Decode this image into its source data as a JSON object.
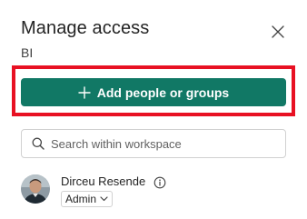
{
  "header": {
    "title": "Manage access",
    "subtitle": "BI"
  },
  "actions": {
    "add_label": "Add people or groups"
  },
  "search": {
    "placeholder": "Search within workspace",
    "value": ""
  },
  "users": [
    {
      "name": "Dirceu Resende",
      "role": "Admin"
    }
  ],
  "colors": {
    "primary": "#117865",
    "highlight": "#e81123",
    "border": "#d1d1d1",
    "text": "#242424"
  },
  "icons": {
    "close": "close-icon",
    "add": "plus-icon",
    "search": "search-icon",
    "info": "info-icon",
    "role_dropdown": "chevron-down-icon"
  }
}
